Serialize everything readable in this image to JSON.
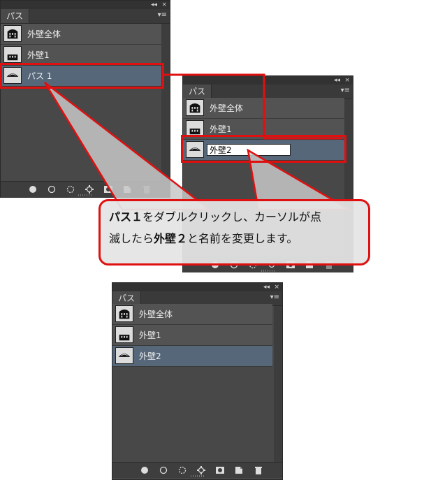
{
  "panel_tab": "パス",
  "panel_controls": {
    "collapse": "◂◂",
    "close": "×",
    "menu": "▾≡"
  },
  "step1": {
    "rows": [
      "外壁全体",
      "外壁1",
      "パス 1"
    ]
  },
  "step2": {
    "rows": [
      "外壁全体",
      "外壁1"
    ],
    "editing_value": "外壁2"
  },
  "step3": {
    "rows": [
      "外壁全体",
      "外壁1",
      "外壁2"
    ]
  },
  "callout": {
    "t1": "パス１",
    "t2": "をダブルクリックし、カーソルが点",
    "t3": "滅したら",
    "t4": "外壁２",
    "t5": "と名前を変更します。"
  },
  "bottom_icons": [
    "fill-path-icon",
    "stroke-path-icon",
    "load-selection-icon",
    "make-work-path-icon",
    "add-mask-icon",
    "new-path-icon",
    "trash-icon"
  ],
  "colors": {
    "highlight": "#e01010",
    "selected_row": "#56677a",
    "panel": "#484848"
  }
}
